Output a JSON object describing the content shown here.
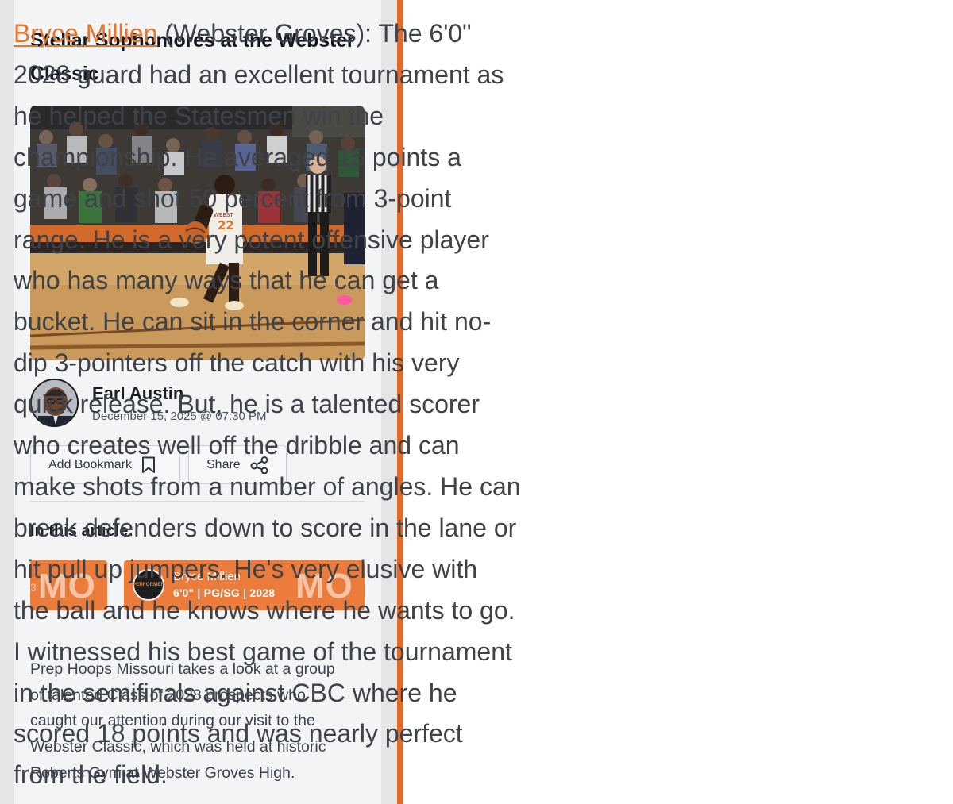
{
  "article": {
    "title_line1": "Stellar Sophomores at the Webster",
    "title_line2": "Classic",
    "author": {
      "name": "Earl Austin",
      "date": "December 15, 2025 @ 07:30 PM"
    },
    "actions": {
      "bookmark_label": "Add Bookmark",
      "bookmark_icon": "bookmark-icon",
      "share_label": "Share",
      "share_icon": "share-icon"
    },
    "in_article_label": "In this article:",
    "player_tags": [
      {
        "state": "MO",
        "partial_number": "3"
      },
      {
        "state": "MO",
        "logo_text": "PERFORMER",
        "name": "Bryce Millien",
        "info": "6'0\" | PG/SG | 2028"
      }
    ],
    "summary_lines": [
      "Prep Hoops Missouri takes a look at a group",
      "of talented Class of 2028 prospects who",
      "caught our attention during our visit to the",
      "Webster Classic, which was held at historic",
      "Roberts Gym at Webster Groves High."
    ]
  },
  "profile": {
    "player_link": "Bryce Millien",
    "first_line_rest": " (Webster Groves): The 6'0\"",
    "lines": [
      "2028 guard had an excellent tournament as",
      "he helped the Statesmen win the",
      "championship. He averaged 15 points a",
      "game and shot 50 percent from 3-point",
      "range. He is a very potent offensive player",
      "who has many ways that he can get a",
      "bucket. He can sit in the corner and hit no-",
      "dip 3-pointers off the catch with his very",
      "quick release. But, he is a talented scorer",
      "who creates well off the dribble and can",
      "make shots from a number of angles. He can",
      "break defenders down to score in the lane or",
      "hit pull up jumpers. He's very elusive with",
      "the ball and he knows where he wants to go.",
      "I witnessed his best game of the tournament",
      "in the semifinals against CBC where he",
      "scored 18 points and was nearly perfect",
      "from the field."
    ]
  },
  "photo": {
    "jersey_text": "WEBST",
    "jersey_number": "22"
  },
  "colors": {
    "accent_orange": "#ec7c3c",
    "divider_orange": "#e06b2b",
    "link_orange": "#e4762e"
  }
}
